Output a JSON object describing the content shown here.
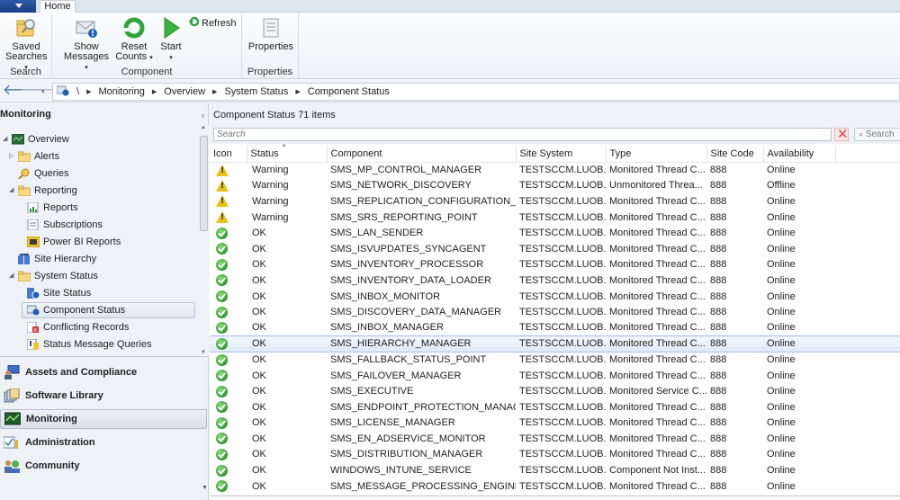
{
  "ribbon": {
    "tabs": [
      {
        "label": "Home",
        "active": true
      }
    ],
    "groups": [
      {
        "label": "Search",
        "buttons": [
          {
            "label_line1": "Saved",
            "label_line2": "Searches",
            "icon": "saved-searches-icon",
            "dropdown": true
          }
        ]
      },
      {
        "label": "Component",
        "buttons": [
          {
            "label_line1": "Show",
            "label_line2": "Messages",
            "icon": "show-messages-icon",
            "dropdown": true
          },
          {
            "label_line1": "Reset",
            "label_line2": "Counts",
            "icon": "reset-counts-icon",
            "dropdown": true
          },
          {
            "label_line1": "Start",
            "label_line2": "",
            "icon": "start-icon",
            "dropdown": true
          },
          {
            "label_line1": "Refresh",
            "label_line2": "",
            "icon": "refresh-icon",
            "dropdown": false
          }
        ]
      },
      {
        "label": "Properties",
        "buttons": [
          {
            "label_line1": "Properties",
            "label_line2": "",
            "icon": "properties-icon",
            "dropdown": false
          }
        ]
      }
    ]
  },
  "address_bar": {
    "root": "\\",
    "crumbs": [
      "Monitoring",
      "Overview",
      "System Status",
      "Component Status"
    ]
  },
  "navigation": {
    "title": "Monitoring",
    "tree": [
      {
        "label": "Overview",
        "icon": "overview-icon",
        "level": 0,
        "expander": "expanded"
      },
      {
        "label": "Alerts",
        "icon": "folder-icon",
        "level": 1,
        "expander": "collapsed"
      },
      {
        "label": "Queries",
        "icon": "queries-icon",
        "level": 1,
        "expander": "none"
      },
      {
        "label": "Reporting",
        "icon": "folder-icon",
        "level": 1,
        "expander": "expanded"
      },
      {
        "label": "Reports",
        "icon": "reports-icon",
        "level": 2,
        "expander": "none"
      },
      {
        "label": "Subscriptions",
        "icon": "subscriptions-icon",
        "level": 2,
        "expander": "none"
      },
      {
        "label": "Power BI Reports",
        "icon": "power-bi-icon",
        "level": 2,
        "expander": "none"
      },
      {
        "label": "Site Hierarchy",
        "icon": "site-hierarchy-icon",
        "level": 1,
        "expander": "none"
      },
      {
        "label": "System Status",
        "icon": "folder-icon",
        "level": 1,
        "expander": "expanded"
      },
      {
        "label": "Site Status",
        "icon": "site-status-icon",
        "level": 2,
        "expander": "none"
      },
      {
        "label": "Component Status",
        "icon": "component-status-icon",
        "level": 2,
        "expander": "none",
        "selected": true
      },
      {
        "label": "Conflicting Records",
        "icon": "conflicting-records-icon",
        "level": 2,
        "expander": "none"
      },
      {
        "label": "Status Message Queries",
        "icon": "status-message-queries-icon",
        "level": 2,
        "expander": "none"
      }
    ],
    "workspaces": [
      {
        "label": "Assets and Compliance",
        "icon": "assets-compliance-icon"
      },
      {
        "label": "Software Library",
        "icon": "software-library-icon"
      },
      {
        "label": "Monitoring",
        "icon": "monitoring-icon",
        "active": true
      },
      {
        "label": "Administration",
        "icon": "administration-icon"
      },
      {
        "label": "Community",
        "icon": "community-icon"
      }
    ]
  },
  "main": {
    "title": "Component Status",
    "item_count": "71 items",
    "search": {
      "placeholder": "Search",
      "value": "",
      "button_label": "Search"
    },
    "columns": [
      "Icon",
      "Status",
      "Component",
      "Site System",
      "Type",
      "Site Code",
      "Availability"
    ],
    "sorted_column": "Status",
    "rows": [
      {
        "icon": "warning",
        "status": "Warning",
        "component": "SMS_MP_CONTROL_MANAGER",
        "site_system": "TESTSCCM.LUOB...",
        "type": "Monitored Thread C...",
        "site_code": "888",
        "availability": "Online"
      },
      {
        "icon": "warning",
        "status": "Warning",
        "component": "SMS_NETWORK_DISCOVERY",
        "site_system": "TESTSCCM.LUOB...",
        "type": "Unmonitored Threa...",
        "site_code": "888",
        "availability": "Offline"
      },
      {
        "icon": "warning",
        "status": "Warning",
        "component": "SMS_REPLICATION_CONFIGURATION_M...",
        "site_system": "TESTSCCM.LUOB...",
        "type": "Monitored Thread C...",
        "site_code": "888",
        "availability": "Online"
      },
      {
        "icon": "warning",
        "status": "Warning",
        "component": "SMS_SRS_REPORTING_POINT",
        "site_system": "TESTSCCM.LUOB...",
        "type": "Monitored Thread C...",
        "site_code": "888",
        "availability": "Online"
      },
      {
        "icon": "ok",
        "status": "OK",
        "component": "SMS_LAN_SENDER",
        "site_system": "TESTSCCM.LUOB...",
        "type": "Monitored Thread C...",
        "site_code": "888",
        "availability": "Online"
      },
      {
        "icon": "ok",
        "status": "OK",
        "component": "SMS_ISVUPDATES_SYNCAGENT",
        "site_system": "TESTSCCM.LUOB...",
        "type": "Monitored Thread C...",
        "site_code": "888",
        "availability": "Online"
      },
      {
        "icon": "ok",
        "status": "OK",
        "component": "SMS_INVENTORY_PROCESSOR",
        "site_system": "TESTSCCM.LUOB...",
        "type": "Monitored Thread C...",
        "site_code": "888",
        "availability": "Online"
      },
      {
        "icon": "ok",
        "status": "OK",
        "component": "SMS_INVENTORY_DATA_LOADER",
        "site_system": "TESTSCCM.LUOB...",
        "type": "Monitored Thread C...",
        "site_code": "888",
        "availability": "Online"
      },
      {
        "icon": "ok",
        "status": "OK",
        "component": "SMS_INBOX_MONITOR",
        "site_system": "TESTSCCM.LUOB...",
        "type": "Monitored Thread C...",
        "site_code": "888",
        "availability": "Online"
      },
      {
        "icon": "ok",
        "status": "OK",
        "component": "SMS_DISCOVERY_DATA_MANAGER",
        "site_system": "TESTSCCM.LUOB...",
        "type": "Monitored Thread C...",
        "site_code": "888",
        "availability": "Online"
      },
      {
        "icon": "ok",
        "status": "OK",
        "component": "SMS_INBOX_MANAGER",
        "site_system": "TESTSCCM.LUOB...",
        "type": "Monitored Thread C...",
        "site_code": "888",
        "availability": "Online"
      },
      {
        "icon": "ok",
        "status": "OK",
        "component": "SMS_HIERARCHY_MANAGER",
        "site_system": "TESTSCCM.LUOB...",
        "type": "Monitored Thread C...",
        "site_code": "888",
        "availability": "Online",
        "selected": true
      },
      {
        "icon": "ok",
        "status": "OK",
        "component": "SMS_FALLBACK_STATUS_POINT",
        "site_system": "TESTSCCM.LUOB...",
        "type": "Monitored Thread C...",
        "site_code": "888",
        "availability": "Online"
      },
      {
        "icon": "ok",
        "status": "OK",
        "component": "SMS_FAILOVER_MANAGER",
        "site_system": "TESTSCCM.LUOB...",
        "type": "Monitored Thread C...",
        "site_code": "888",
        "availability": "Online"
      },
      {
        "icon": "ok",
        "status": "OK",
        "component": "SMS_EXECUTIVE",
        "site_system": "TESTSCCM.LUOB...",
        "type": "Monitored Service C...",
        "site_code": "888",
        "availability": "Online"
      },
      {
        "icon": "ok",
        "status": "OK",
        "component": "SMS_ENDPOINT_PROTECTION_MANAGER",
        "site_system": "TESTSCCM.LUOB...",
        "type": "Monitored Thread C...",
        "site_code": "888",
        "availability": "Online"
      },
      {
        "icon": "ok",
        "status": "OK",
        "component": "SMS_LICENSE_MANAGER",
        "site_system": "TESTSCCM.LUOB...",
        "type": "Monitored Thread C...",
        "site_code": "888",
        "availability": "Online"
      },
      {
        "icon": "ok",
        "status": "OK",
        "component": "SMS_EN_ADSERVICE_MONITOR",
        "site_system": "TESTSCCM.LUOB...",
        "type": "Monitored Thread C...",
        "site_code": "888",
        "availability": "Online"
      },
      {
        "icon": "ok",
        "status": "OK",
        "component": "SMS_DISTRIBUTION_MANAGER",
        "site_system": "TESTSCCM.LUOB...",
        "type": "Monitored Thread C...",
        "site_code": "888",
        "availability": "Online"
      },
      {
        "icon": "ok",
        "status": "OK",
        "component": "WINDOWS_INTUNE_SERVICE",
        "site_system": "TESTSCCM.LUOB...",
        "type": "Component Not Inst...",
        "site_code": "888",
        "availability": "Online"
      },
      {
        "icon": "ok",
        "status": "OK",
        "component": "SMS_MESSAGE_PROCESSING_ENGINE",
        "site_system": "TESTSCCM.LUOB...",
        "type": "Monitored Thread C...",
        "site_code": "888",
        "availability": "Online"
      }
    ]
  }
}
